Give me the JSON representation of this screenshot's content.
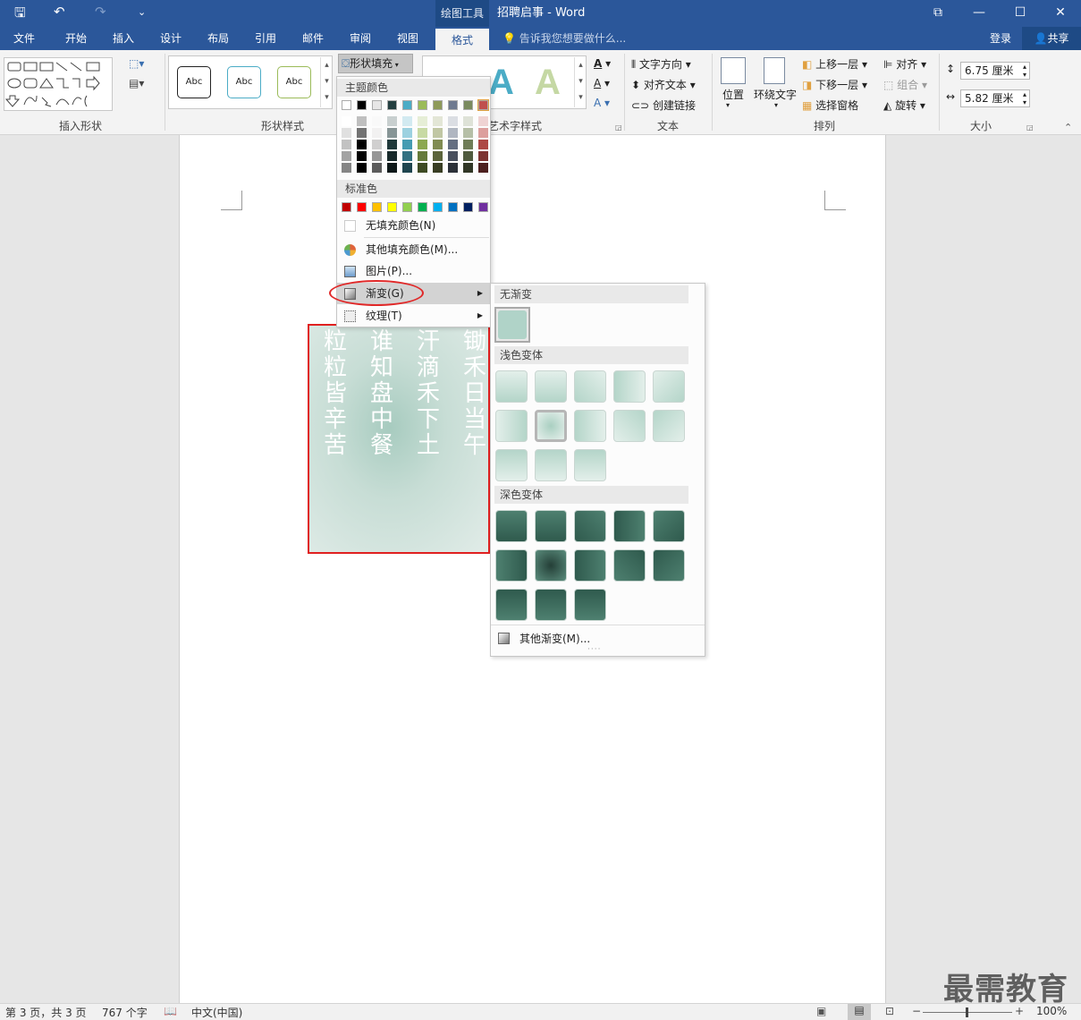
{
  "titlebar": {
    "context_tab": "绘图工具",
    "title": "招聘启事 - Word",
    "qa_save": "🖫",
    "qa_undo": "↶",
    "qa_redo": "↷",
    "qa_customize": "⌄",
    "restore_ribbon": "⧉",
    "minimize": "—",
    "maximize": "☐",
    "close": "✕"
  },
  "tabs": [
    "文件",
    "开始",
    "插入",
    "设计",
    "布局",
    "引用",
    "邮件",
    "审阅",
    "视图",
    "格式"
  ],
  "active_tab": "格式",
  "tellme": "告诉我您想要做什么...",
  "login": "登录",
  "share": "共享",
  "ribbon": {
    "groups": {
      "insert_shapes": "插入形状",
      "shape_styles": "形状样式",
      "wordart_styles": "艺术字样式",
      "text": "文本",
      "arrange": "排列",
      "size": "大小"
    },
    "style_sample": "Abc",
    "shape_fill": "形状填充",
    "text_direction": "文字方向",
    "align_text": "对齐文本",
    "create_link": "创建链接",
    "position": "位置",
    "wrap_text": "环绕文字",
    "bring_forward": "上移一层",
    "send_backward": "下移一层",
    "selection_pane": "选择窗格",
    "align": "对齐",
    "group": "组合",
    "rotate": "旋转",
    "height": "6.75 厘米",
    "width": "5.82 厘米",
    "wordart_letter": "A"
  },
  "poem": {
    "columns": [
      "锄禾日当午",
      "汗滴禾下土",
      "谁知盘中餐",
      "粒粒皆辛苦"
    ]
  },
  "fill_menu": {
    "theme_colors_header": "主题颜色",
    "theme_colors": [
      "#ffffff",
      "#000000",
      "#e7e6e6",
      "#243f40",
      "#4bacc6",
      "#9bbb59",
      "#8e9a5a",
      "#6f7a8f",
      "#7a8a5f",
      "#c0504d"
    ],
    "standard_colors_header": "标准色",
    "standard_colors": [
      "#c00000",
      "#ff0000",
      "#ffc000",
      "#ffff00",
      "#92d050",
      "#00b050",
      "#00b0f0",
      "#0070c0",
      "#002060",
      "#7030a0"
    ],
    "no_fill": "无填充颜色(N)",
    "more_colors": "其他填充颜色(M)...",
    "picture": "图片(P)...",
    "gradient": "渐变(G)",
    "texture": "纹理(T)"
  },
  "gradient_submenu": {
    "no_gradient": "无渐变",
    "light_variations": "浅色变体",
    "dark_variations": "深色变体",
    "more_gradients": "其他渐变(M)..."
  },
  "statusbar": {
    "page": "第 3 页，共 3 页",
    "words": "767 个字",
    "language": "中文(中国)",
    "zoom": "100%"
  },
  "watermark": "最需教育"
}
